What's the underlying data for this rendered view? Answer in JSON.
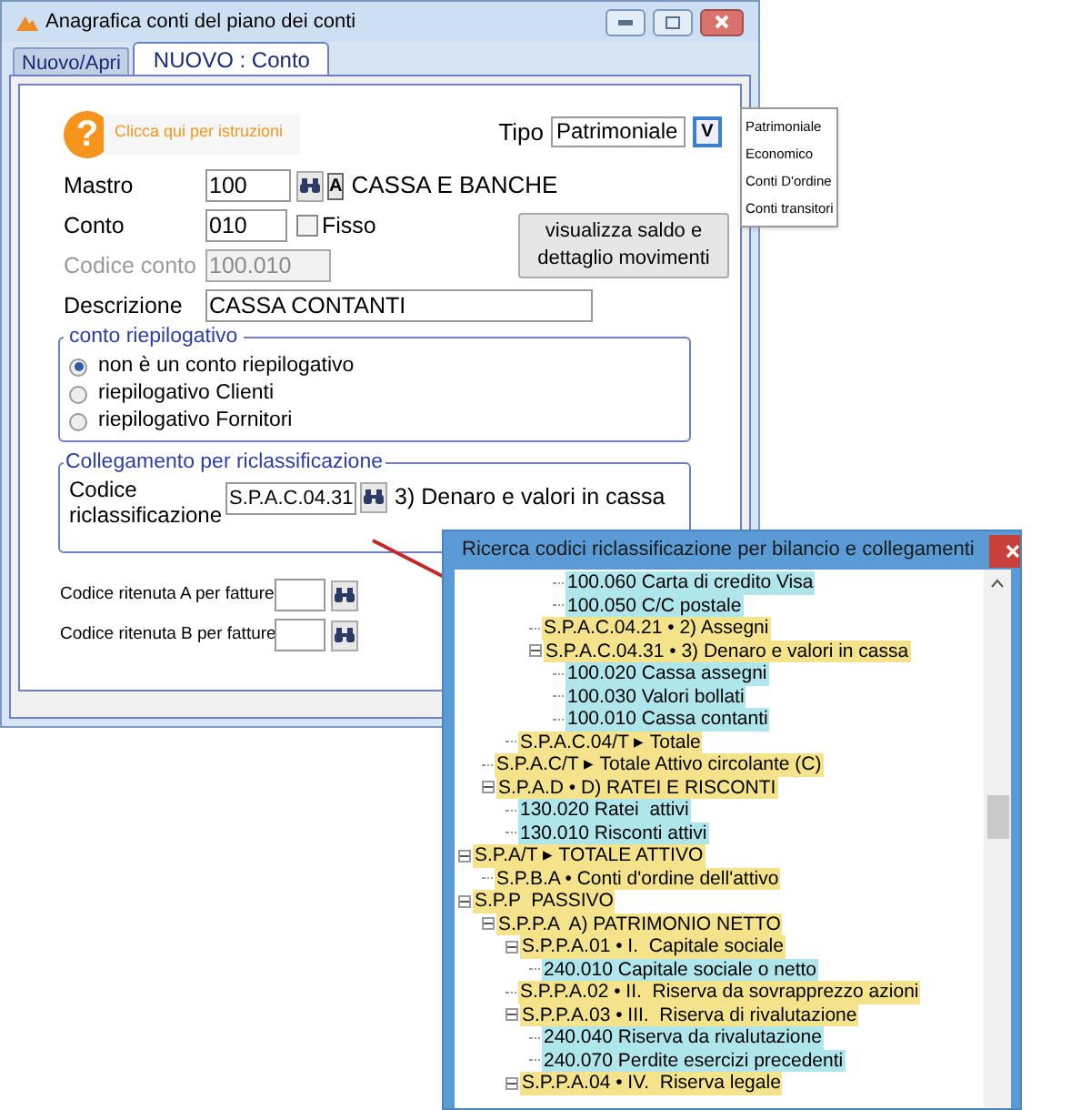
{
  "window": {
    "title": "Anagrafica conti del piano dei conti"
  },
  "tabs": [
    {
      "label": "Nuovo/Apri",
      "selected": false
    },
    {
      "label": "NUOVO : Conto",
      "selected": true
    }
  ],
  "help": {
    "glyph": "?",
    "text": "Clicca qui per istruzioni"
  },
  "tipo": {
    "label": "Tipo",
    "value": "Patrimoniale",
    "button": "V",
    "options": [
      "Patrimoniale",
      "Economico",
      "Conti D'ordine",
      "Conti transitori"
    ]
  },
  "fields": [
    {
      "kind": "lookup",
      "label": "Mastro",
      "value": "100",
      "button": "A",
      "description": "CASSA E BANCHE"
    },
    {
      "kind": "check",
      "label": "Conto",
      "value": "010",
      "check_label": "Fisso",
      "checked": false
    },
    {
      "kind": "readonly",
      "label": "Codice conto",
      "value": "100.010"
    },
    {
      "kind": "text",
      "label": "Descrizione",
      "value": "CASSA CONTANTI"
    }
  ],
  "saldo_button": "visualizza saldo e dettaglio movimenti",
  "riepilogo": {
    "title": "conto riepilogativo",
    "options": [
      {
        "label": "non è un conto riepilogativo",
        "selected": true
      },
      {
        "label": "riepilogativo Clienti",
        "selected": false
      },
      {
        "label": "riepilogativo Fornitori",
        "selected": false
      }
    ]
  },
  "collegamento": {
    "title": "Collegamento per riclassificazione",
    "label": "Codice riclassificazione",
    "value": "S.P.A.C.04.31",
    "description": "3) Denaro e valori in cassa"
  },
  "ritenute": [
    {
      "label": "Codice ritenuta A per fatture"
    },
    {
      "label": "Codice ritenuta B per fatture"
    }
  ],
  "popup": {
    "title": "Ricerca codici riclassificazione per bilancio e collegamenti",
    "tree": [
      {
        "children": [
          {
            "children": [
              {
                "children": [
                  {
                    "children": [
                      {
                        "label": "100.060 Carta di credito Visa",
                        "kind": "account"
                      },
                      {
                        "label": "100.050 C/C postale",
                        "kind": "account"
                      }
                    ]
                  },
                  {
                    "label": "S.P.A.C.04.21 • 2) Assegni",
                    "kind": "group"
                  },
                  {
                    "label": "S.P.A.C.04.31 • 3) Denaro e valori in cassa",
                    "kind": "group",
                    "expanded": true,
                    "children": [
                      {
                        "label": "100.020 Cassa assegni",
                        "kind": "account"
                      },
                      {
                        "label": "100.030 Valori bollati",
                        "kind": "account"
                      },
                      {
                        "label": "100.010 Cassa contanti",
                        "kind": "account"
                      }
                    ]
                  }
                ]
              },
              {
                "label": "S.P.A.C.04/T ▸ Totale",
                "kind": "group"
              }
            ]
          },
          {
            "label": "S.P.A.C/T ▸ Totale Attivo circolante (C)",
            "kind": "group"
          },
          {
            "label": "S.P.A.D • D) RATEI E RISCONTI",
            "kind": "group",
            "expanded": true,
            "children": [
              {
                "label": "130.020 Ratei  attivi",
                "kind": "account"
              },
              {
                "label": "130.010 Risconti attivi",
                "kind": "account"
              }
            ]
          }
        ]
      },
      {
        "label": "S.P.A/T ▸ TOTALE ATTIVO",
        "kind": "group",
        "expanded": true,
        "children": [
          {
            "label": "S.P.B.A • Conti d'ordine dell'attivo",
            "kind": "group"
          }
        ]
      },
      {
        "label": "S.P.P  PASSIVO",
        "kind": "group",
        "expanded": true,
        "children": [
          {
            "label": "S.P.P.A  A) PATRIMONIO NETTO",
            "kind": "group",
            "expanded": true,
            "children": [
              {
                "label": "S.P.P.A.01 • I.  Capitale sociale",
                "kind": "group",
                "expanded": true,
                "children": [
                  {
                    "label": "240.010 Capitale sociale o netto",
                    "kind": "account"
                  }
                ]
              },
              {
                "label": "S.P.P.A.02 • II.  Riserva da sovrapprezzo azioni",
                "kind": "group"
              },
              {
                "label": "S.P.P.A.03 • III.  Riserva di rivalutazione",
                "kind": "group",
                "expanded": true,
                "children": [
                  {
                    "label": "240.040 Riserva da rivalutazione",
                    "kind": "account"
                  },
                  {
                    "label": "240.070 Perdite esercizi precedenti",
                    "kind": "account"
                  }
                ]
              },
              {
                "label": "S.P.P.A.04 • IV.  Riserva legale",
                "kind": "group",
                "expanded": true
              }
            ]
          }
        ]
      }
    ]
  }
}
